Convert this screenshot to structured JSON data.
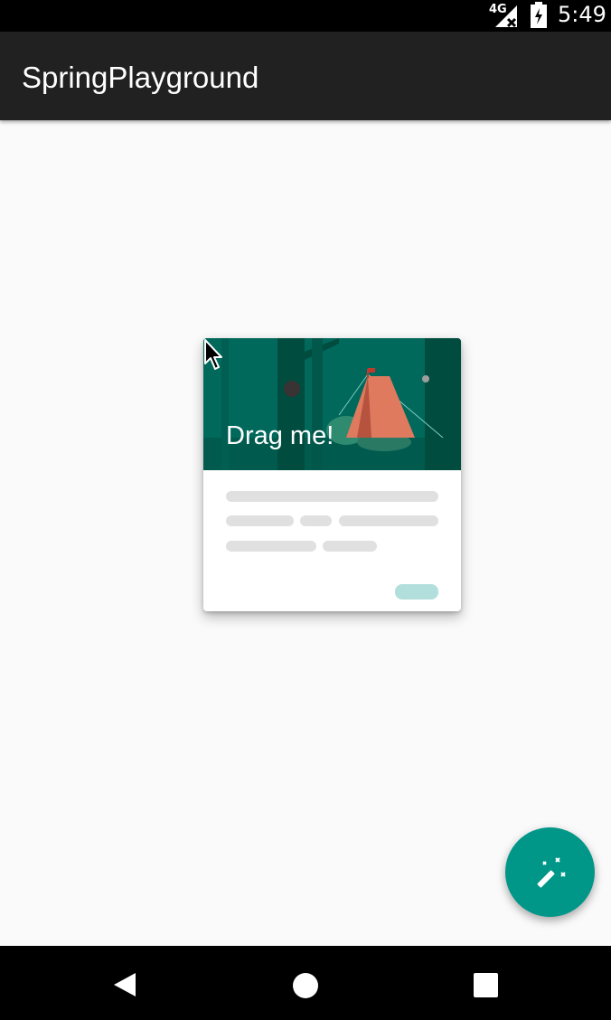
{
  "status_bar": {
    "network": "4G",
    "time": "5:49",
    "icons": [
      "signal-icon",
      "battery-icon"
    ]
  },
  "app_bar": {
    "title": "SpringPlayground"
  },
  "card": {
    "label": "Drag me!",
    "hero_color": "#00695c",
    "action_color": "#b2dfdb"
  },
  "fab": {
    "icon": "magic-wand-icon",
    "color": "#009688"
  },
  "nav_bar": {
    "buttons": [
      "back-icon",
      "home-icon",
      "recents-icon"
    ]
  }
}
